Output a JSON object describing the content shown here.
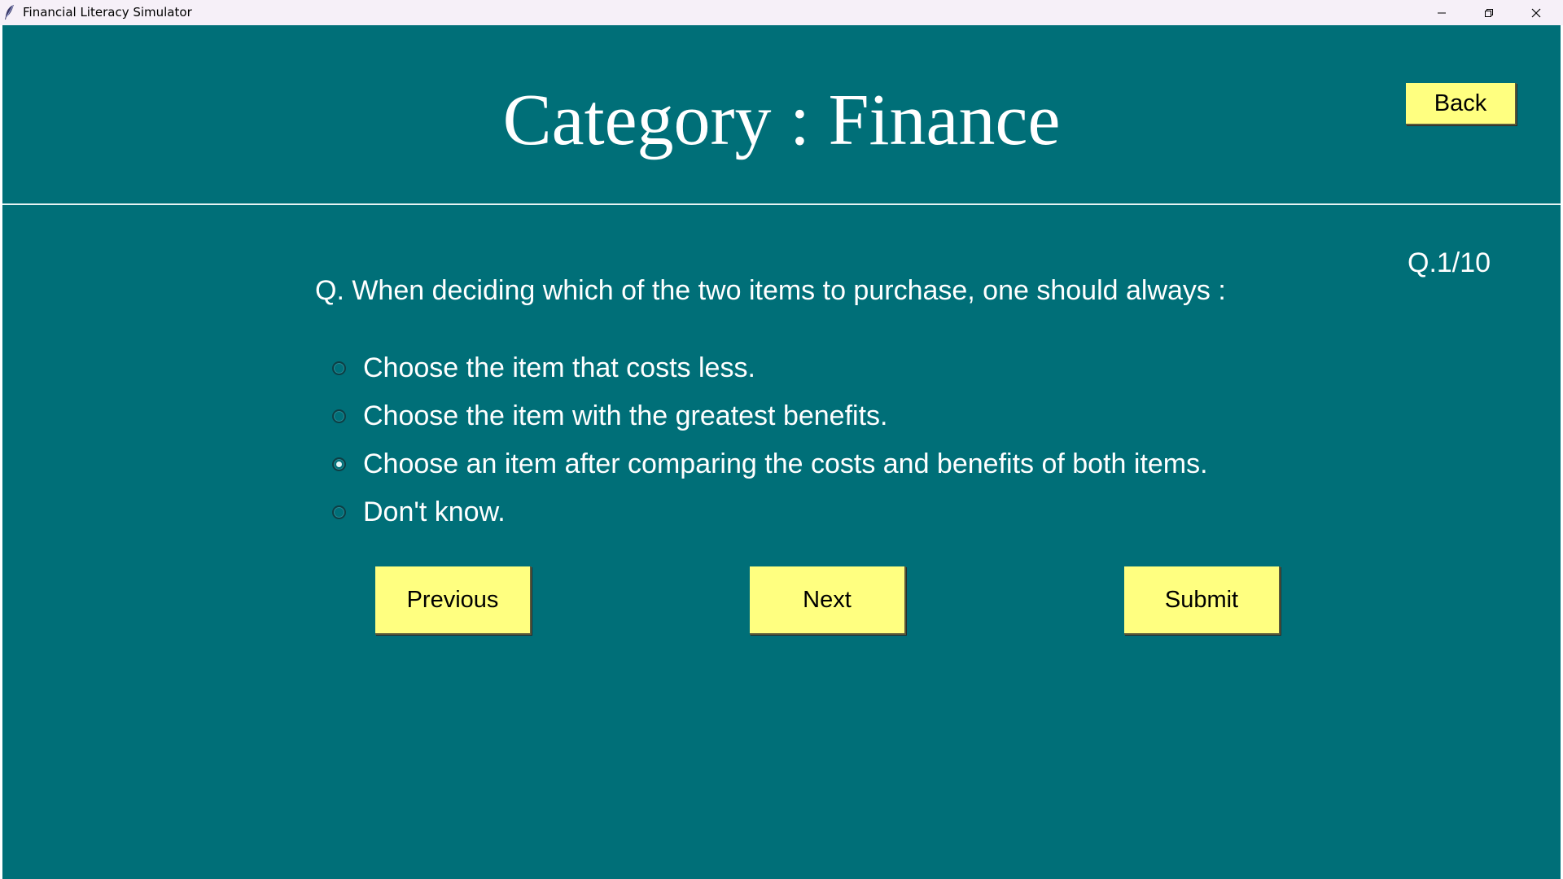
{
  "window": {
    "title": "Financial Literacy Simulator",
    "icon": "feather-icon",
    "controls": [
      "minimize-icon",
      "restore-icon",
      "close-icon"
    ]
  },
  "header": {
    "title": "Category : Finance",
    "back_label": "Back"
  },
  "quiz": {
    "counter": "Q.1/10",
    "question": "Q. When deciding which of the two items to purchase, one should always :",
    "options": [
      {
        "label": "Choose the item that costs less.",
        "selected": false
      },
      {
        "label": "Choose the item with the greatest benefits.",
        "selected": false
      },
      {
        "label": "Choose an item after comparing the costs and benefits of both items.",
        "selected": true
      },
      {
        "label": "Don't know.",
        "selected": false
      }
    ]
  },
  "nav": {
    "previous_label": "Previous",
    "next_label": "Next",
    "submit_label": "Submit"
  },
  "colors": {
    "background": "#006f78",
    "button": "#ffff80",
    "text": "#ffffff",
    "titlebar": "#f6f0f8"
  }
}
